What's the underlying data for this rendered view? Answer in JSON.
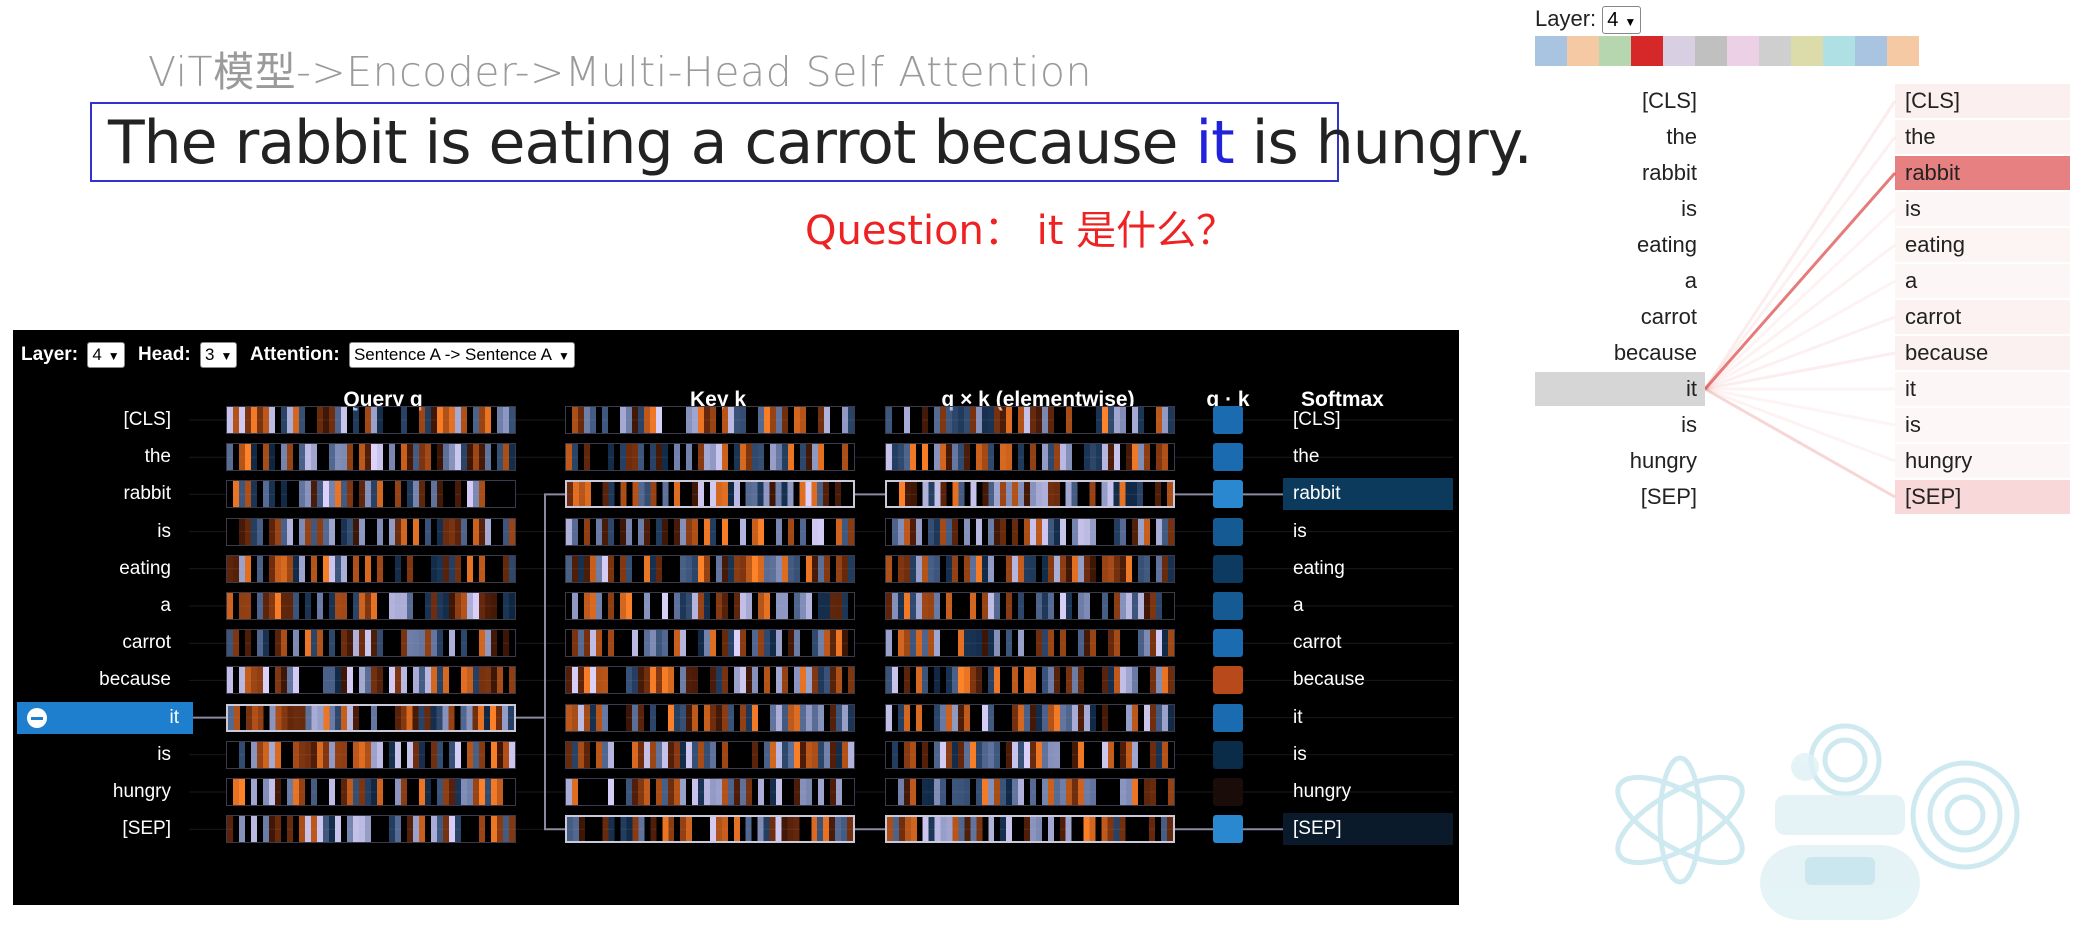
{
  "header": {
    "breadcrumb": "ViT模型->Encoder->Multi-Head Self Attention",
    "sentence_before": "The rabbit is eating a carrot because ",
    "sentence_highlight": "it",
    "sentence_after": " is hungry.",
    "question": "Question： it 是什么？"
  },
  "attention_panel": {
    "layer_label": "Layer:",
    "layer_value": "4",
    "head_label": "Head:",
    "head_value": "3",
    "attention_label": "Attention:",
    "attention_value": "Sentence A -> Sentence A",
    "col_query": "Query q",
    "col_key": "Key k",
    "col_qk": "q × k (elementwise)",
    "col_dot": "q · k",
    "col_softmax": "Softmax",
    "tokens": [
      "[CLS]",
      "the",
      "rabbit",
      "is",
      "eating",
      "a",
      "carrot",
      "because",
      "it",
      "is",
      "hungry",
      "[SEP]"
    ],
    "selected_query_token": "it",
    "highlighted_keys": [
      "rabbit",
      "[SEP]"
    ],
    "dot_colors": [
      "#1a6bb0",
      "#1a6bb0",
      "#2a88d0",
      "#165a94",
      "#0d3a60",
      "#165a94",
      "#1a6bb0",
      "#b8491a",
      "#1a6bb0",
      "#0b2c48",
      "#1a0c08",
      "#2a88d0"
    ]
  },
  "right_view": {
    "layer_label": "Layer:",
    "layer_value": "4",
    "head_colors": [
      "#a9c4e0",
      "#f4c9a4",
      "#b6d6b0",
      "#d62828",
      "#d8d0e2",
      "#c0c0c0",
      "#ecd0e6",
      "#cfcfcf",
      "#dcdcaa",
      "#aee0e4",
      "#a9c4e0",
      "#f4c9a4"
    ],
    "active_head_index": 3,
    "left_tokens": [
      "[CLS]",
      "the",
      "rabbit",
      "is",
      "eating",
      "a",
      "carrot",
      "because",
      "it",
      "is",
      "hungry",
      "[SEP]"
    ],
    "right_tokens": [
      "[CLS]",
      "the",
      "rabbit",
      "is",
      "eating",
      "a",
      "carrot",
      "because",
      "it",
      "is",
      "hungry",
      "[SEP]"
    ],
    "selected_left_token": "it",
    "attention_weights": [
      0.06,
      0.04,
      0.75,
      0.02,
      0.03,
      0.02,
      0.04,
      0.05,
      0.02,
      0.01,
      0.02,
      0.2
    ]
  }
}
